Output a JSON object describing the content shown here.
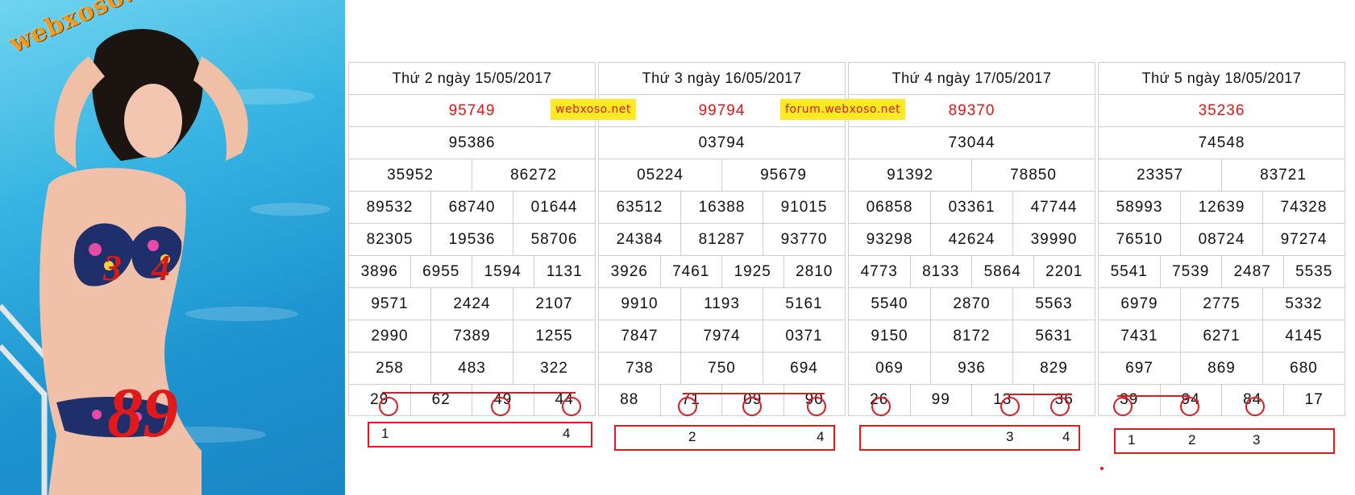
{
  "brand": {
    "text": "webxoso.net"
  },
  "photo": {
    "big_number": "89",
    "small_digit_left": "3",
    "small_digit_right": "4"
  },
  "tags": [
    "webxoso.net",
    "forum.webxoso.net"
  ],
  "days": [
    {
      "date": "Thứ 2 ngày 15/05/2017",
      "special": "95749",
      "first": [
        "95386"
      ],
      "second": [
        "35952",
        "86272"
      ],
      "third": [
        [
          "89532",
          "68740",
          "01644"
        ],
        [
          "82305",
          "19536",
          "58706"
        ]
      ],
      "fourth": [
        "3896",
        "6955",
        "1594",
        "1131"
      ],
      "fifth": [
        [
          "9571",
          "2424",
          "2107"
        ],
        [
          "2990",
          "7389",
          "1255"
        ]
      ],
      "sixth": [
        "258",
        "483",
        "322"
      ],
      "seventh": [
        "29",
        "62",
        "49",
        "44"
      ],
      "markers": [
        "1",
        "4"
      ]
    },
    {
      "date": "Thứ 3 ngày 16/05/2017",
      "special": "99794",
      "first": [
        "03794"
      ],
      "second": [
        "05224",
        "95679"
      ],
      "third": [
        [
          "63512",
          "16388",
          "91015"
        ],
        [
          "24384",
          "81287",
          "93770"
        ]
      ],
      "fourth": [
        "3926",
        "7461",
        "1925",
        "2810"
      ],
      "fifth": [
        [
          "9910",
          "1193",
          "5161"
        ],
        [
          "7847",
          "7974",
          "0371"
        ]
      ],
      "sixth": [
        "738",
        "750",
        "694"
      ],
      "seventh": [
        "88",
        "71",
        "09",
        "90"
      ],
      "markers": [
        "2",
        "4"
      ]
    },
    {
      "date": "Thứ 4 ngày 17/05/2017",
      "special": "89370",
      "first": [
        "73044"
      ],
      "second": [
        "91392",
        "78850"
      ],
      "third": [
        [
          "06858",
          "03361",
          "47744"
        ],
        [
          "93298",
          "42624",
          "39990"
        ]
      ],
      "fourth": [
        "4773",
        "8133",
        "5864",
        "2201"
      ],
      "fifth": [
        [
          "5540",
          "2870",
          "5563"
        ],
        [
          "9150",
          "8172",
          "5631"
        ]
      ],
      "sixth": [
        "069",
        "936",
        "829"
      ],
      "seventh": [
        "26",
        "99",
        "13",
        "36"
      ],
      "markers": [
        "3",
        "4"
      ]
    },
    {
      "date": "Thứ 5 ngày 18/05/2017",
      "special": "35236",
      "first": [
        "74548"
      ],
      "second": [
        "23357",
        "83721"
      ],
      "third": [
        [
          "58993",
          "12639",
          "74328"
        ],
        [
          "76510",
          "08724",
          "97274"
        ]
      ],
      "fourth": [
        "5541",
        "7539",
        "2487",
        "5535"
      ],
      "fifth": [
        [
          "6979",
          "2775",
          "5332"
        ],
        [
          "7431",
          "6271",
          "4145"
        ]
      ],
      "sixth": [
        "697",
        "869",
        "680"
      ],
      "seventh": [
        "39",
        "94",
        "84",
        "17"
      ],
      "markers": [
        "1",
        "2",
        "3"
      ]
    }
  ],
  "colors": {
    "accent_red": "#e0191b",
    "tag_yellow": "#ffe924",
    "grid": "#cfcfcf"
  }
}
